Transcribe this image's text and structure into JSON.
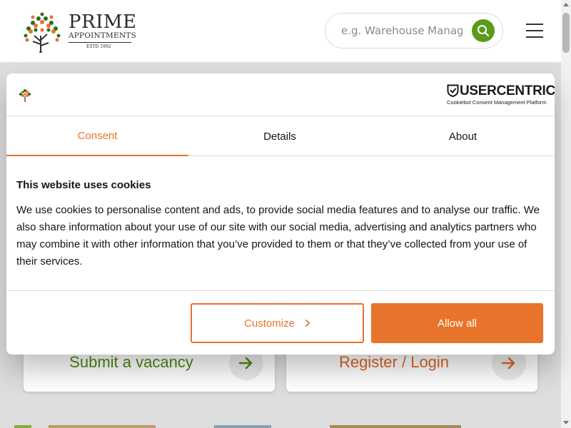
{
  "header": {
    "logo": {
      "line1": "PRIME",
      "line2": "APPOINTMENTS",
      "est": "ESTD 1992",
      "icon": "orange-tree-logo"
    },
    "search": {
      "placeholder": "e.g. Warehouse Manager",
      "icon": "search-icon",
      "button_color": "#5a9a1b"
    },
    "menu_icon": "hamburger-menu-icon"
  },
  "cards": [
    {
      "label": "Submit a vacancy",
      "icon": "arrow-right-icon",
      "color": "#4e8a15"
    },
    {
      "label": "Register / Login",
      "icon": "arrow-right-icon",
      "color": "#e0662a"
    }
  ],
  "cookie_dialog": {
    "brand": {
      "name": "USERCENTRICS",
      "sub": "Cookiebot Consent Management Platform",
      "icon": "usercentrics-shield-icon"
    },
    "tabs": [
      {
        "label": "Consent",
        "active": true
      },
      {
        "label": "Details",
        "active": false
      },
      {
        "label": "About",
        "active": false
      }
    ],
    "title": "This website uses cookies",
    "text": "We use cookies to personalise content and ads, to provide social media features and to analyse our traffic. We also share information about your use of our site with our social media, advertising and analytics partners who may combine it with other information that you’ve provided to them or that they’ve collected from your use of their services.",
    "buttons": {
      "customize": "Customize",
      "allow_all": "Allow all"
    },
    "accent_color": "#e8732a"
  }
}
